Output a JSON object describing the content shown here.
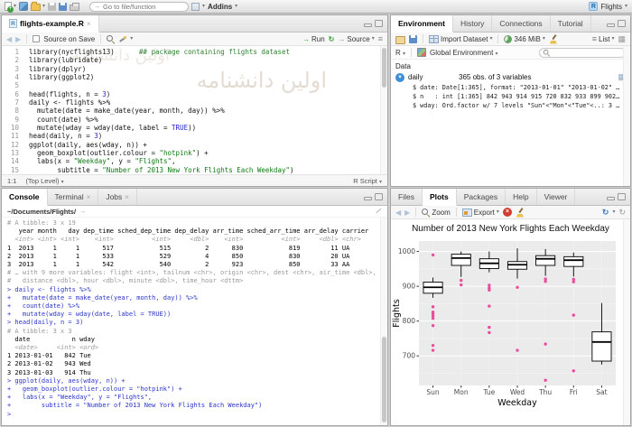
{
  "watermark": "اولین دانشنامه",
  "icons": {
    "caret": "▾",
    "close": "×",
    "back": "◀",
    "forward": "▶",
    "run_arrow": "→",
    "rerun": "↻",
    "source_arrow": "→",
    "outline": "≡",
    "goto_arrow": "→",
    "list": "≡",
    "grid": "▦",
    "viewtable": "▦",
    "publish": "↻",
    "refresh": "↻",
    "plus": "+",
    "stop_x": "×",
    "expand": "▾",
    "rletter": "R"
  },
  "main_toolbar": {
    "goto_placeholder": "Go to file/function",
    "addins": "Addins",
    "project": "Flights"
  },
  "source_pane": {
    "tab": "flights-example.R",
    "toolbar": {
      "source_on_save": "Source on Save",
      "run": "Run",
      "source": "Source"
    },
    "status": {
      "cursor": "1:1",
      "scope": "(Top Level)",
      "type": "R Script"
    },
    "code_lines": [
      [
        [
          "library(nycflights13)      "
        ],
        [
          "## package containing flights dataset",
          "c"
        ]
      ],
      [
        [
          "library(lubridate)"
        ]
      ],
      [
        [
          "library(dplyr)"
        ]
      ],
      [
        [
          "library(ggplot2)"
        ]
      ],
      [
        [
          ""
        ]
      ],
      [
        [
          "head(flights, n = "
        ],
        [
          "3",
          "n"
        ],
        [
          ")"
        ]
      ],
      [
        [
          "daily <- flights %>%"
        ]
      ],
      [
        [
          "  mutate(date = make_date(year, month, day)) %>%"
        ]
      ],
      [
        [
          "  count(date) %>%"
        ]
      ],
      [
        [
          "  mutate(wday = wday(date, label = "
        ],
        [
          "TRUE",
          "n"
        ],
        [
          "))"
        ]
      ],
      [
        [
          "head(daily, n = "
        ],
        [
          "3",
          "n"
        ],
        [
          ")"
        ]
      ],
      [
        [
          "ggplot(daily, aes(wday, n)) +"
        ]
      ],
      [
        [
          "  geom_boxplot(outlier.colour = "
        ],
        [
          "\"hotpink\"",
          "s"
        ],
        [
          ") +"
        ]
      ],
      [
        [
          "  labs(x = "
        ],
        [
          "\"Weekday\"",
          "s"
        ],
        [
          ", y = "
        ],
        [
          "\"Flights\"",
          "s"
        ],
        [
          ","
        ]
      ],
      [
        [
          "       subtitle = "
        ],
        [
          "\"Number of 2013 New York Flights Each Weekday\"",
          "s"
        ],
        [
          ")"
        ]
      ],
      [
        [
          ""
        ]
      ]
    ]
  },
  "console_pane": {
    "tabs": [
      "Console",
      "Terminal",
      "Jobs"
    ],
    "path": "~/Documents/Flights/",
    "lines": [
      {
        "c": "meta",
        "t": "# A tibble: 3 x 19"
      },
      {
        "c": "out",
        "t": "   year month   day dep_time sched_dep_time dep_delay arr_time sched_arr_time arr_delay carrier"
      },
      {
        "c": "type",
        "t": "  <int> <int> <int>    <int>          <int>     <dbl>    <int>          <int>     <dbl> <chr>"
      },
      {
        "c": "out",
        "t": "1  2013     1     1      517            515         2      830            819        11 UA"
      },
      {
        "c": "out",
        "t": "2  2013     1     1      533            529         4      850            830        20 UA"
      },
      {
        "c": "out",
        "t": "3  2013     1     1      542            540         2      923            850        33 AA"
      },
      {
        "c": "meta",
        "t": "# … with 9 more variables: flight <int>, tailnum <chr>, origin <chr>, dest <chr>, air_time <dbl>,"
      },
      {
        "c": "meta",
        "t": "#   distance <dbl>, hour <dbl>, minute <dbl>, time_hour <dttm>"
      },
      {
        "c": "in",
        "t": "> daily <- flights %>%"
      },
      {
        "c": "in",
        "t": "+   mutate(date = make_date(year, month, day)) %>%"
      },
      {
        "c": "in",
        "t": "+   count(date) %>%"
      },
      {
        "c": "in",
        "t": "+   mutate(wday = wday(date, label = TRUE))"
      },
      {
        "c": "in",
        "t": "> head(daily, n = 3)"
      },
      {
        "c": "meta",
        "t": "# A tibble: 3 x 3"
      },
      {
        "c": "out",
        "t": "  date           n wday"
      },
      {
        "c": "type",
        "t": "  <date>     <int> <ord>"
      },
      {
        "c": "out",
        "t": "1 2013-01-01   842 Tue"
      },
      {
        "c": "out",
        "t": "2 2013-01-02   943 Wed"
      },
      {
        "c": "out",
        "t": "3 2013-01-03   914 Thu"
      },
      {
        "c": "in",
        "t": "> ggplot(daily, aes(wday, n)) +"
      },
      {
        "c": "in",
        "t": "+   geom_boxplot(outlier.colour = \"hotpink\") +"
      },
      {
        "c": "in",
        "t": "+   labs(x = \"Weekday\", y = \"Flights\","
      },
      {
        "c": "in",
        "t": "+        subtitle = \"Number of 2013 New York Flights Each Weekday\")"
      },
      {
        "c": "in",
        "t": "> "
      }
    ]
  },
  "environment_pane": {
    "tabs": [
      "Environment",
      "History",
      "Connections",
      "Tutorial"
    ],
    "toolbar": {
      "import": "Import Dataset",
      "memory": "346 MiB",
      "view": "List"
    },
    "scope": {
      "lang": "R",
      "env": "Global Environment"
    },
    "section": "Data",
    "objects": [
      {
        "name": "daily",
        "summary": "365 obs. of 3 variables",
        "details": [
          "$ date: Date[1:365], format: \"2013-01-01\" \"2013-01-02\" …",
          "$ n   : int [1:365] 842 943 914 915 720 832 933 899 902…",
          "$ wday: Ord.factor w/ 7 levels \"Sun\"<\"Mon\"<\"Tue\"<..: 3 …"
        ]
      }
    ]
  },
  "plots_pane": {
    "tabs": [
      "Files",
      "Plots",
      "Packages",
      "Help",
      "Viewer"
    ],
    "toolbar": {
      "zoom": "Zoom",
      "export": "Export"
    }
  },
  "chart_data": {
    "type": "boxplot",
    "title": "Number of 2013 New York Flights Each Weekday",
    "xlabel": "Weekday",
    "ylabel": "Flights",
    "categories": [
      "Sun",
      "Mon",
      "Tue",
      "Wed",
      "Thu",
      "Fri",
      "Sat"
    ],
    "ylim": [
      615,
      1030
    ],
    "yticks": [
      700,
      800,
      900,
      1000
    ],
    "yticks_minor": [
      650,
      750,
      850,
      950
    ],
    "grid": true,
    "panel_color": "#EBEBEB",
    "outlier_color": "#EA4C9B",
    "series": [
      {
        "category": "Sun",
        "low": 867,
        "q1": 880,
        "median": 897,
        "q3": 912,
        "high": 925,
        "outliers": [
          990,
          841,
          826,
          821,
          815,
          808,
          787,
          730,
          716
        ]
      },
      {
        "category": "Mon",
        "low": 927,
        "q1": 960,
        "median": 981,
        "q3": 992,
        "high": 1000,
        "outliers": [
          917,
          904
        ]
      },
      {
        "category": "Tue",
        "low": 940,
        "q1": 951,
        "median": 966,
        "q3": 979,
        "high": 1000,
        "outliers": [
          903,
          895,
          889,
          843,
          782,
          767
        ]
      },
      {
        "category": "Wed",
        "low": 922,
        "q1": 949,
        "median": 962,
        "q3": 971,
        "high": 1009,
        "outliers": [
          897,
          716
        ]
      },
      {
        "category": "Thu",
        "low": 930,
        "q1": 960,
        "median": 979,
        "q3": 988,
        "high": 1007,
        "outliers": [
          921,
          914,
          734,
          630
        ]
      },
      {
        "category": "Fri",
        "low": 928,
        "q1": 957,
        "median": 975,
        "q3": 985,
        "high": 997,
        "outliers": [
          920,
          913,
          817,
          657
        ]
      },
      {
        "category": "Sat",
        "low": 675,
        "q1": 685,
        "median": 740,
        "q3": 769,
        "high": 852,
        "outliers": []
      }
    ]
  }
}
